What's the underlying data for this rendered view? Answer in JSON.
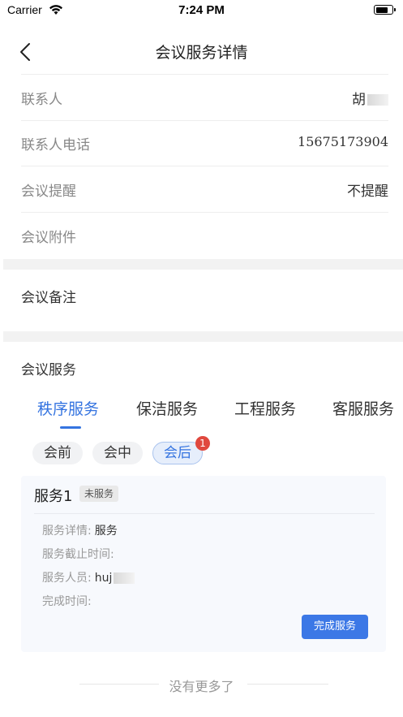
{
  "status_bar": {
    "carrier": "Carrier",
    "time": "7:24 PM"
  },
  "nav": {
    "title": "会议服务详情"
  },
  "info_rows": [
    {
      "label": "联系人",
      "value": "胡"
    },
    {
      "label": "联系人电话",
      "value": "15675173904"
    },
    {
      "label": "会议提醒",
      "value": "不提醒"
    },
    {
      "label": "会议附件",
      "value": ""
    }
  ],
  "remark": {
    "label": "会议备注"
  },
  "services": {
    "title": "会议服务",
    "tabs": [
      "秩序服务",
      "保洁服务",
      "工程服务",
      "客服服务"
    ],
    "active_tab": 0,
    "phases": [
      "会前",
      "会中",
      "会后"
    ],
    "active_phase": 2,
    "badge_count": "1"
  },
  "card": {
    "title": "服务1",
    "status": "未服务",
    "details": [
      {
        "label": "服务详情:",
        "value": "服务"
      },
      {
        "label": "服务截止时间:",
        "value": ""
      },
      {
        "label": "服务人员:",
        "value": "huj"
      },
      {
        "label": "完成时间:",
        "value": ""
      }
    ],
    "button": "完成服务"
  },
  "footer": {
    "text": "没有更多了"
  },
  "colors": {
    "accent": "#3574e0",
    "badge": "#e0483e",
    "divider": "#f2f2f2"
  },
  "icons": [
    "wifi-icon",
    "battery-icon",
    "back-chevron-icon"
  ]
}
